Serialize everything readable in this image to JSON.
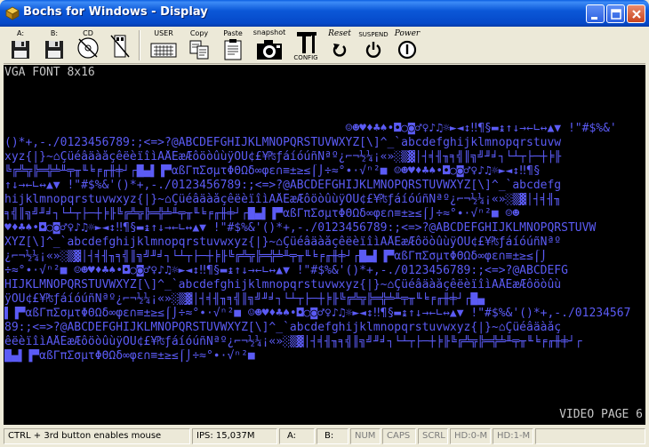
{
  "window": {
    "title": "Bochs for Windows - Display"
  },
  "toolbar": {
    "floppy_a": "A:",
    "floppy_b": "B:",
    "cdrom": "CD",
    "user": "USER",
    "copy": "Copy",
    "paste": "Paste",
    "snapshot": "snapshot",
    "config": "CONFIG",
    "reset": "Reset",
    "suspend": "SUSPEND",
    "power": "Power"
  },
  "display": {
    "heading": "VGA FONT 8x16",
    "page_label": "VIDEO PAGE 6",
    "text_color": "#5b5bf5",
    "glyph_rows": [
      "                                                 ☺☻♥♦♣♠•◘○◙♂♀♪♫☼►◄↕‼¶§▬↨↑↓→←∟↔▲▼ !\"#$%&'",
      "()*+,-./0123456789:;<=>?@ABCDEFGHIJKLMNOPQRSTUVWXYZ[\\]^_`abcdefghijklmnopqrstuvw",
      "xyz{|}~⌂ÇüéâäàåçêëèïîìÄÅÉæÆôöòûùÿÖÜ¢£¥₧ƒáíóúñÑªº¿⌐¬½¼¡«»░▒▓│┤╡╢╖╕╣║╗╝╜╛┐└┴┬├─┼╞╟",
      "╚╔╩╦╠═╬╧╨╤╥╙╘╒╓╫╪┘┌█▄▌▐▀αßΓπΣσµτΦΘΩδ∞φε∩≡±≥≤⌠⌡÷≈°∙·√ⁿ²■ ☺☻♥♦♣♠•◘○◙♂♀♪♫☼►◄↕‼¶§",
      "↑↓→←∟↔▲▼ !\"#$%&'()*+,-./0123456789:;<=>?@ABCDEFGHIJKLMNOPQRSTUVWXYZ[\\]^_`abcdefg",
      "hijklmnopqrstuvwxyz{|}~⌂ÇüéâäàåçêëèïîìÄÅÉæÆôöòûùÿÖÜ¢£¥₧ƒáíóúñÑªº¿⌐¬½¼¡«»░▒▓│┤╡╢╖",
      "╕╣║╗╝╜╛┐└┴┬├─┼╞╟╚╔╩╦╠═╬╧╨╤╥╙╘╒╓╫╪┘┌█▄▌▐▀αßΓπΣσµτΦΘΩδ∞φε∩≡±≥≤⌠⌡÷≈°∙·√ⁿ²■ ☺☻",
      "♥♦♣♠•◘○◙♂♀♪♫☼►◄↕‼¶§▬↨↑↓→←∟↔▲▼ !\"#$%&'()*+,-./0123456789:;<=>?@ABCDEFGHIJKLMNOPQRSTUVW",
      "XYZ[\\]^_`abcdefghijklmnopqrstuvwxyz{|}~⌂ÇüéâäàåçêëèïîìÄÅÉæÆôöòûùÿÖÜ¢£¥₧ƒáíóúñÑªº",
      "¿⌐¬½¼¡«»░▒▓│┤╡╢╖╕╣║╗╝╜╛┐└┴┬├─┼╞╟╚╔╩╦╠═╬╧╨╤╥╙╘╒╓╫╪┘┌█▄▌▐▀αßΓπΣσµτΦΘΩδ∞φε∩≡±≥≤⌠⌡",
      "÷≈°∙·√ⁿ²■ ☺☻♥♦♣♠•◘○◙♂♀♪♫☼►◄↕‼¶§▬↨↑↓→←∟↔▲▼ !\"#$%&'()*+,-./0123456789:;<=>?@ABCDEFG",
      "HIJKLMNOPQRSTUVWXYZ[\\]^_`abcdefghijklmnopqrstuvwxyz{|}~⌂ÇüéâäàåçêëèïîìÄÅÉæÆôöòûù",
      "ÿÖÜ¢£¥₧ƒáíóúñÑªº¿⌐¬½¼¡«»░▒▓│┤╡╢╖╕╣║╗╝╜╛┐└┴┬├─┼╞╟╚╔╩╦╠═╬╧╨╤╥╙╘╒╓╫╪┘┌█▄",
      "▌▐▀αßΓπΣσµτΦΘΩδ∞φε∩≡±≥≤⌠⌡÷≈°∙·√ⁿ²■ ☺☻♥♦♣♠•◘○◙♂♀♪♫☼►◄↕‼¶§▬↨↑↓→←∟↔▲▼ !\"#$%&'()*+,-./01234567",
      "89:;<=>?@ABCDEFGHIJKLMNOPQRSTUVWXYZ[\\]^_`abcdefghijklmnopqrstuvwxyz{|}~⌂Çüéâäàåç",
      "êëèïîìÄÅÉæÆôöòûùÿÖÜ¢£¥₧ƒáíóúñÑªº¿⌐¬½¼¡«»░▒▓│┤╡╢╖╕╣║╗╝╜╛┐└┴┬├─┼╞╟╚╔╩╦╠═╬╧╨╤╥╙╘╒╓╫╪┘┌",
      "█▄▌▐▀αßΓπΣσµτΦΘΩδ∞φε∩≡±≥≤⌠⌡÷≈°∙·√ⁿ²■"
    ]
  },
  "statusbar": {
    "hint": "CTRL + 3rd button enables mouse",
    "ips": "IPS: 15,037M",
    "a": "A:",
    "b": "B:",
    "num": "NUM",
    "caps": "CAPS",
    "scrl": "SCRL",
    "hd0": "HD:0-M",
    "hd1": "HD:1-M"
  }
}
